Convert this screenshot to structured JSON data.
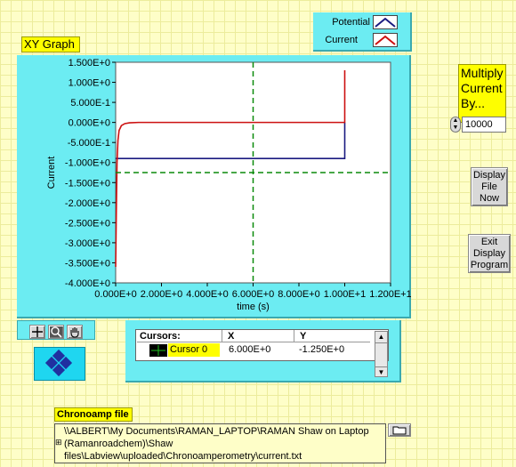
{
  "graph": {
    "label": "XY Graph",
    "xlabel": "time (s)",
    "ylabel": "Current",
    "x_ticks": [
      "0.000E+0",
      "2.000E+0",
      "4.000E+0",
      "6.000E+0",
      "8.000E+0",
      "1.000E+1",
      "1.200E+1"
    ],
    "y_ticks": [
      "1.500E+0",
      "1.000E+0",
      "5.000E-1",
      "0.000E+0",
      "-5.000E-1",
      "-1.000E+0",
      "-1.500E+0",
      "-2.000E+0",
      "-2.500E+0",
      "-3.000E+0",
      "-3.500E+0",
      "-4.000E+0"
    ]
  },
  "legend": {
    "items": [
      {
        "name": "Potential",
        "color": "#1a1a80"
      },
      {
        "name": "Current",
        "color": "#cc1010"
      }
    ]
  },
  "chart_data": {
    "type": "line",
    "xlabel": "time (s)",
    "ylabel": "Current",
    "xlim": [
      0,
      12
    ],
    "ylim": [
      -4,
      1.5
    ],
    "grid": false,
    "legend_position": "top-right",
    "series": [
      {
        "name": "Potential",
        "color": "#1a1a80",
        "x": [
          0,
          0.15,
          10,
          10
        ],
        "y": [
          -0.9,
          -0.9,
          -0.9,
          0.0
        ]
      },
      {
        "name": "Current",
        "color": "#cc1010",
        "x": [
          0,
          0.03,
          0.06,
          0.1,
          0.15,
          0.25,
          0.4,
          0.6,
          1.0,
          2.0,
          4.0,
          6.0,
          8.0,
          9.99,
          10.0,
          10.0
        ],
        "y": [
          -3.6,
          -2.2,
          -1.0,
          -0.45,
          -0.2,
          -0.08,
          -0.03,
          -0.01,
          0.0,
          0.0,
          0.0,
          0.0,
          0.0,
          0.0,
          0.0,
          1.3
        ]
      }
    ],
    "cursor": {
      "x": 6.0,
      "y": -1.25,
      "color": "#0a8a0a"
    }
  },
  "multiply": {
    "label": "Multiply Current By...",
    "value": "10000"
  },
  "buttons": {
    "display_file": "Display File Now",
    "exit": "Exit Display Program"
  },
  "cursors_table": {
    "headers": [
      "Cursors:",
      "X",
      "Y"
    ],
    "row": {
      "name": "Cursor 0",
      "x": "6.000E+0",
      "y": "-1.250E+0"
    }
  },
  "file": {
    "label": "Chronoamp file",
    "path": "\\\\ALBERT\\My Documents\\RAMAN_LAPTOP\\RAMAN Shaw on Laptop (Ramanroadchem)\\Shaw files\\Labview\\uploaded\\Chronoamperometry\\current.txt"
  }
}
